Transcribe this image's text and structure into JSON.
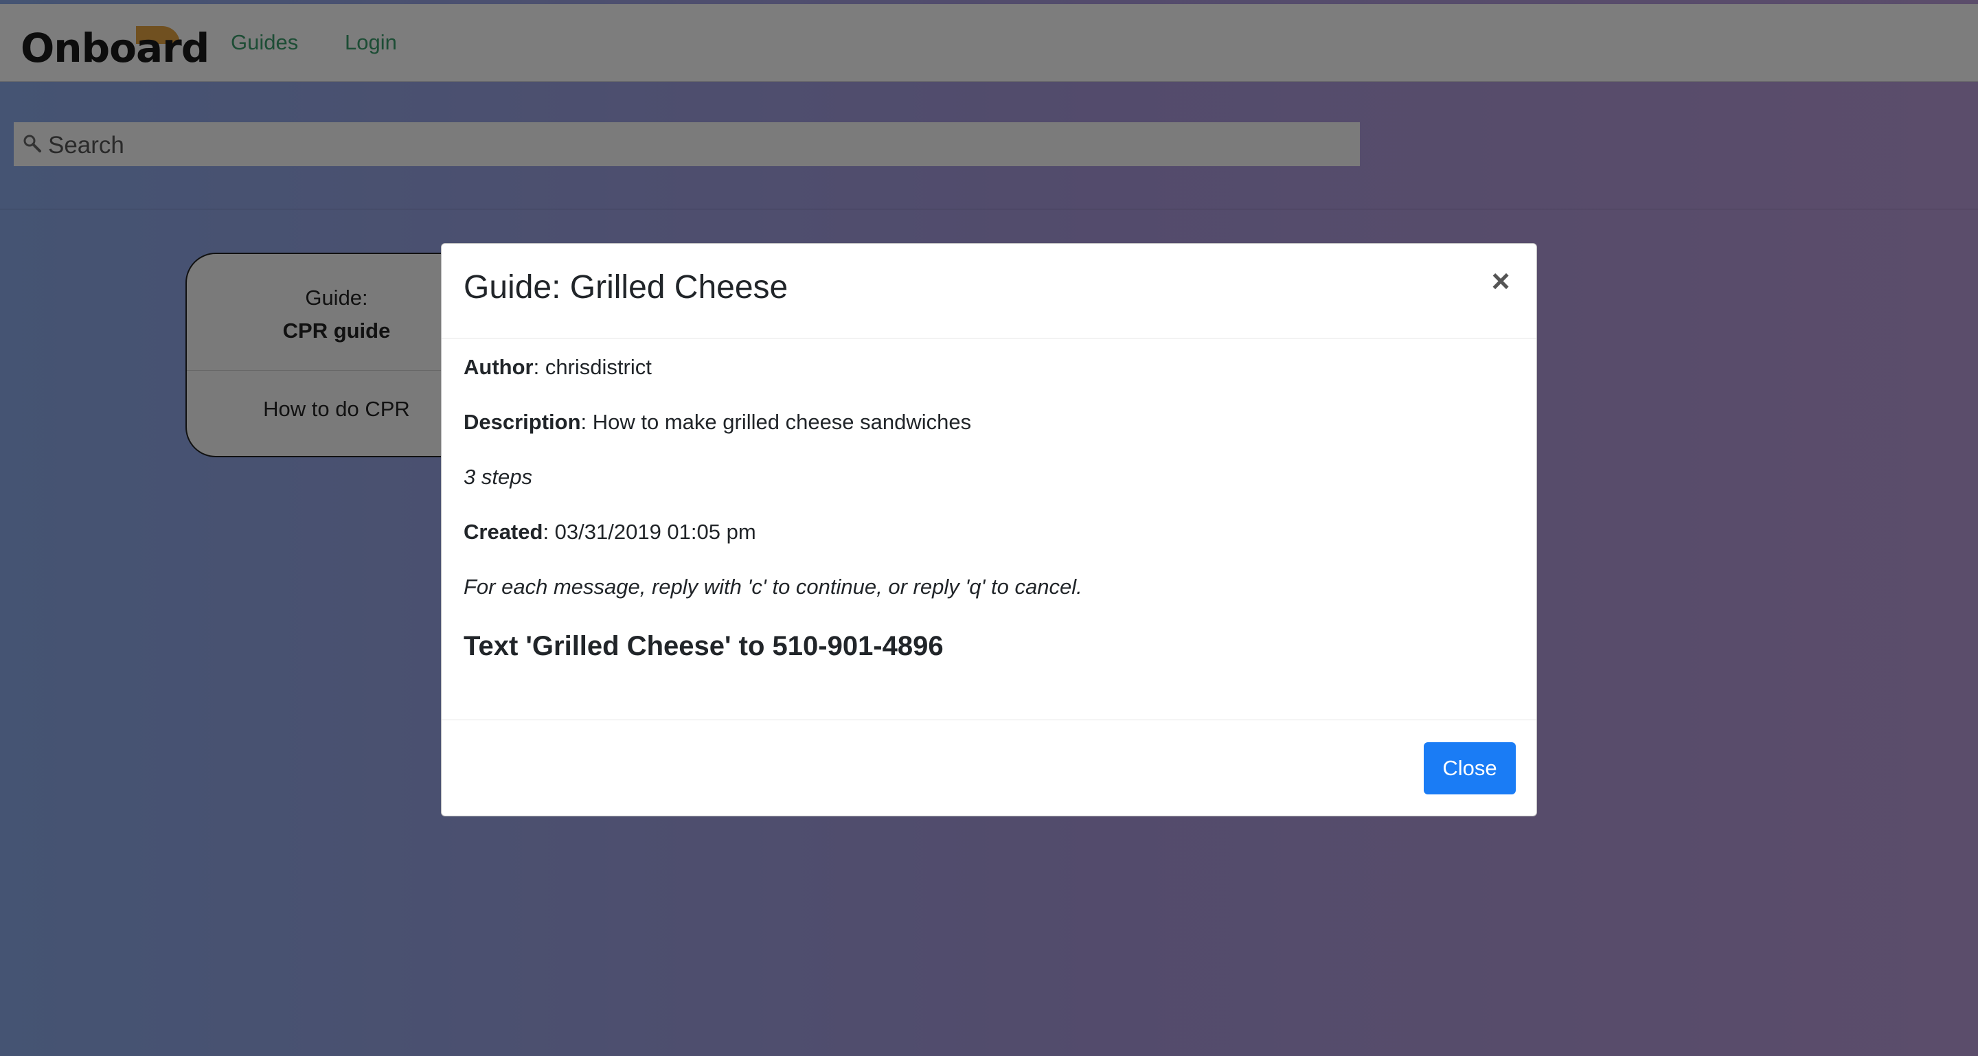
{
  "topbar": {
    "logo_text": "Onboard",
    "nav": [
      {
        "label": "Guides"
      },
      {
        "label": "Login"
      }
    ]
  },
  "search": {
    "placeholder": "Search"
  },
  "guide_card": {
    "prefix": "Guide:",
    "name": "CPR guide",
    "description": "How to do CPR"
  },
  "modal": {
    "title": "Guide: Grilled Cheese",
    "close_x": "×",
    "author_label": "Author",
    "author_value": ": chrisdistrict",
    "description_label": "Description",
    "description_value": ": How to make grilled cheese sandwiches",
    "steps": "3 steps",
    "created_label": "Created",
    "created_value": ": 03/31/2019 01:05 pm",
    "instructions": "For each message, reply with 'c' to continue, or reply 'q' to cancel.",
    "sms_cta": "Text 'Grilled Cheese' to 510-901-4896",
    "close_button": "Close"
  },
  "colors": {
    "accent": "#1a7cf5",
    "nav_link": "#3a9a6a",
    "logo_mark": "#e0a040"
  }
}
